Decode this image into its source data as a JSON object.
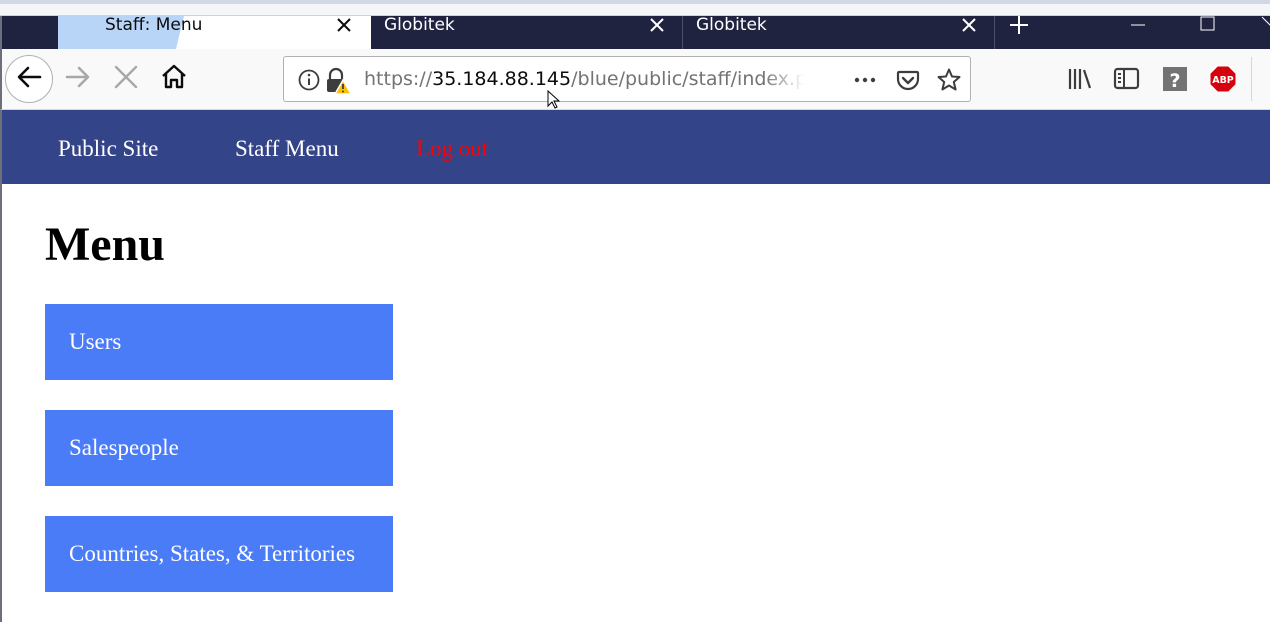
{
  "browser": {
    "tabs": [
      {
        "title": "Staff: Menu",
        "active": true
      },
      {
        "title": "Globitek",
        "active": false
      },
      {
        "title": "Globitek",
        "active": false
      }
    ],
    "url": {
      "scheme": "https://",
      "host": "35.184.88.145",
      "path": "/blue/public/staff/index.ph"
    },
    "icons": {
      "back": "back-arrow-icon",
      "forward": "forward-arrow-icon",
      "stop": "stop-icon",
      "home": "home-icon",
      "info": "info-icon",
      "insecure": "insecure-lock-icon",
      "page_actions": "more-icon",
      "pocket": "pocket-icon",
      "bookmark": "star-icon",
      "library": "library-icon",
      "sidebar": "sidebar-icon",
      "help": "help-icon",
      "adblock": "abp-icon"
    },
    "adblock_label": "ABP",
    "help_label": "?"
  },
  "site_nav": {
    "links": [
      {
        "label": "Public Site"
      },
      {
        "label": "Staff Menu"
      },
      {
        "label": "Log out"
      }
    ],
    "logout_color": "#ff0000",
    "background": "#344488"
  },
  "page": {
    "title": "Menu",
    "menu_items": [
      {
        "label": "Users"
      },
      {
        "label": "Salespeople"
      },
      {
        "label": "Countries, States, & Territories"
      }
    ],
    "menu_color": "#4a7cf7"
  }
}
